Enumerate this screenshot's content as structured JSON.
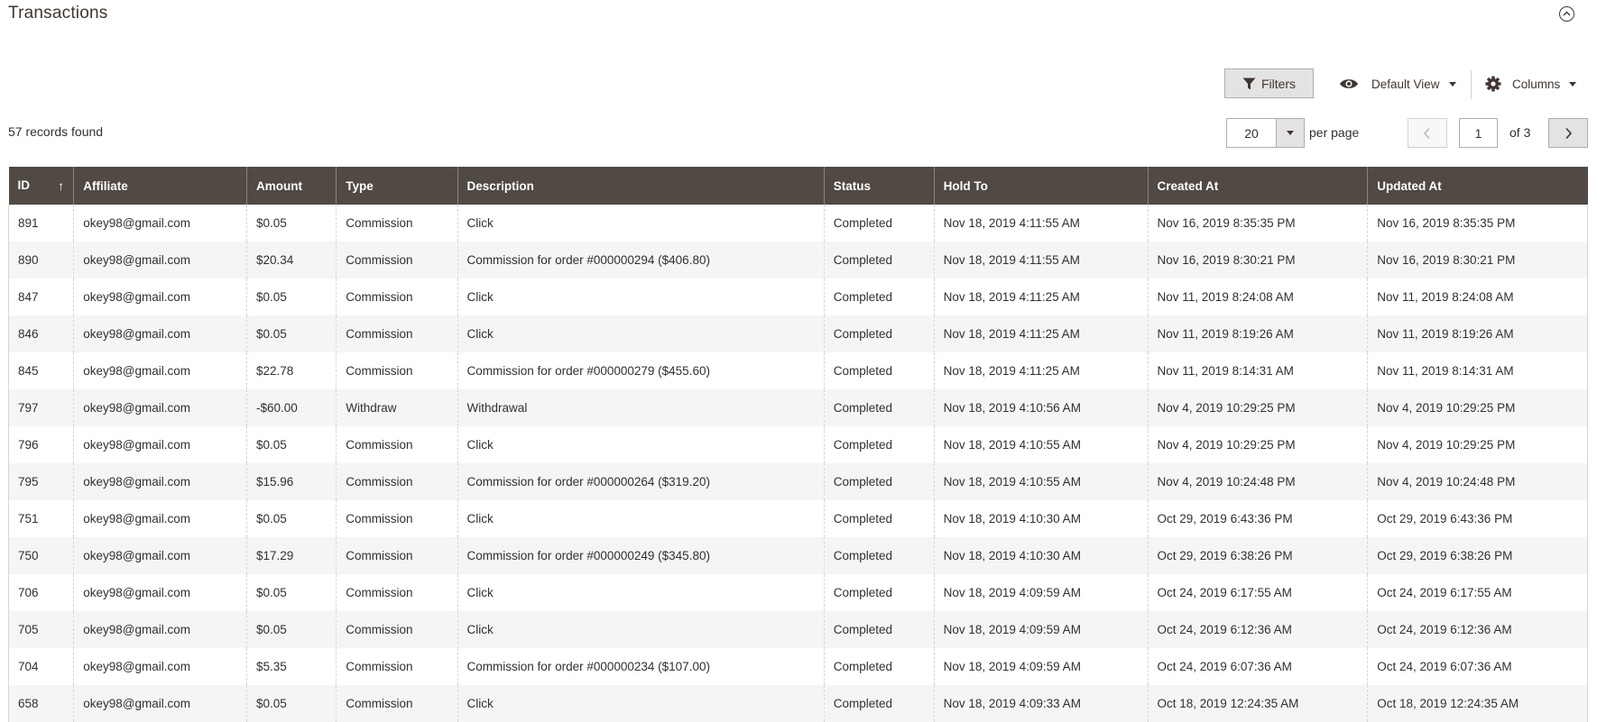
{
  "section": {
    "title": "Transactions"
  },
  "toolbar": {
    "filters_label": "Filters",
    "view_label": "Default View",
    "columns_label": "Columns"
  },
  "records": {
    "text": "57 records found"
  },
  "pagination": {
    "per_page_value": "20",
    "per_page_label": "per page",
    "current_page": "1",
    "total_label": "of 3"
  },
  "table": {
    "columns": [
      "ID",
      "Affiliate",
      "Amount",
      "Type",
      "Description",
      "Status",
      "Hold To",
      "Created At",
      "Updated At"
    ],
    "rows": [
      [
        "891",
        "okey98@gmail.com",
        "$0.05",
        "Commission",
        "Click",
        "Completed",
        "Nov 18, 2019 4:11:55 AM",
        "Nov 16, 2019 8:35:35 PM",
        "Nov 16, 2019 8:35:35 PM"
      ],
      [
        "890",
        "okey98@gmail.com",
        "$20.34",
        "Commission",
        "Commission for order #000000294 ($406.80)",
        "Completed",
        "Nov 18, 2019 4:11:55 AM",
        "Nov 16, 2019 8:30:21 PM",
        "Nov 16, 2019 8:30:21 PM"
      ],
      [
        "847",
        "okey98@gmail.com",
        "$0.05",
        "Commission",
        "Click",
        "Completed",
        "Nov 18, 2019 4:11:25 AM",
        "Nov 11, 2019 8:24:08 AM",
        "Nov 11, 2019 8:24:08 AM"
      ],
      [
        "846",
        "okey98@gmail.com",
        "$0.05",
        "Commission",
        "Click",
        "Completed",
        "Nov 18, 2019 4:11:25 AM",
        "Nov 11, 2019 8:19:26 AM",
        "Nov 11, 2019 8:19:26 AM"
      ],
      [
        "845",
        "okey98@gmail.com",
        "$22.78",
        "Commission",
        "Commission for order #000000279 ($455.60)",
        "Completed",
        "Nov 18, 2019 4:11:25 AM",
        "Nov 11, 2019 8:14:31 AM",
        "Nov 11, 2019 8:14:31 AM"
      ],
      [
        "797",
        "okey98@gmail.com",
        "-$60.00",
        "Withdraw",
        "Withdrawal",
        "Completed",
        "Nov 18, 2019 4:10:56 AM",
        "Nov 4, 2019 10:29:25 PM",
        "Nov 4, 2019 10:29:25 PM"
      ],
      [
        "796",
        "okey98@gmail.com",
        "$0.05",
        "Commission",
        "Click",
        "Completed",
        "Nov 18, 2019 4:10:55 AM",
        "Nov 4, 2019 10:29:25 PM",
        "Nov 4, 2019 10:29:25 PM"
      ],
      [
        "795",
        "okey98@gmail.com",
        "$15.96",
        "Commission",
        "Commission for order #000000264 ($319.20)",
        "Completed",
        "Nov 18, 2019 4:10:55 AM",
        "Nov 4, 2019 10:24:48 PM",
        "Nov 4, 2019 10:24:48 PM"
      ],
      [
        "751",
        "okey98@gmail.com",
        "$0.05",
        "Commission",
        "Click",
        "Completed",
        "Nov 18, 2019 4:10:30 AM",
        "Oct 29, 2019 6:43:36 PM",
        "Oct 29, 2019 6:43:36 PM"
      ],
      [
        "750",
        "okey98@gmail.com",
        "$17.29",
        "Commission",
        "Commission for order #000000249 ($345.80)",
        "Completed",
        "Nov 18, 2019 4:10:30 AM",
        "Oct 29, 2019 6:38:26 PM",
        "Oct 29, 2019 6:38:26 PM"
      ],
      [
        "706",
        "okey98@gmail.com",
        "$0.05",
        "Commission",
        "Click",
        "Completed",
        "Nov 18, 2019 4:09:59 AM",
        "Oct 24, 2019 6:17:55 AM",
        "Oct 24, 2019 6:17:55 AM"
      ],
      [
        "705",
        "okey98@gmail.com",
        "$0.05",
        "Commission",
        "Click",
        "Completed",
        "Nov 18, 2019 4:09:59 AM",
        "Oct 24, 2019 6:12:36 AM",
        "Oct 24, 2019 6:12:36 AM"
      ],
      [
        "704",
        "okey98@gmail.com",
        "$5.35",
        "Commission",
        "Commission for order #000000234 ($107.00)",
        "Completed",
        "Nov 18, 2019 4:09:59 AM",
        "Oct 24, 2019 6:07:36 AM",
        "Oct 24, 2019 6:07:36 AM"
      ],
      [
        "658",
        "okey98@gmail.com",
        "$0.05",
        "Commission",
        "Click",
        "Completed",
        "Nov 18, 2019 4:09:33 AM",
        "Oct 18, 2019 12:24:35 AM",
        "Oct 18, 2019 12:24:35 AM"
      ]
    ]
  },
  "icons": {
    "collapse": "chevron-up-circle-icon",
    "filter": "funnel-icon",
    "view": "eye-icon",
    "columns": "gear-icon",
    "prev": "chevron-left-icon",
    "next": "chevron-right-icon"
  },
  "colors": {
    "header_bg": "#514943",
    "header_text": "#ffffff",
    "row_alt": "#f5f5f5",
    "button_bg": "#e3e3e3",
    "text_dark": "#41362f"
  }
}
